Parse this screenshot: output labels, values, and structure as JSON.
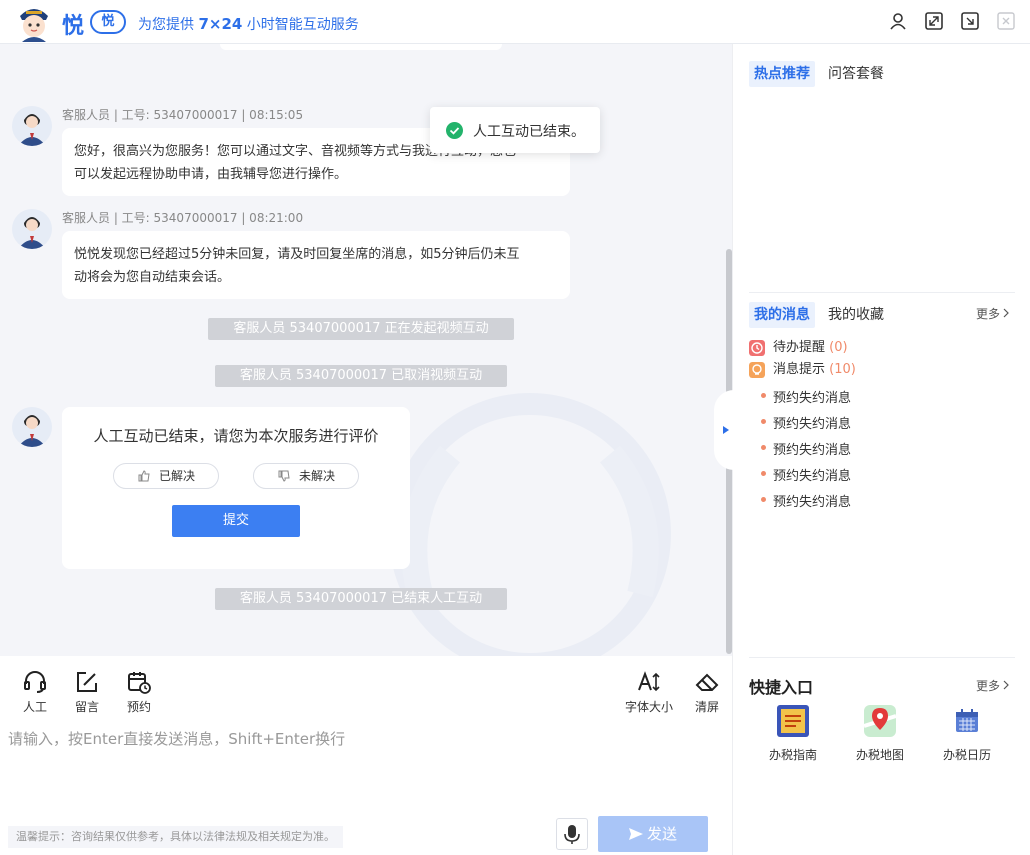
{
  "header": {
    "brand": "悦",
    "brand_badge": "悦",
    "slogan_prefix": "为您提供 ",
    "slogan_highlight": "7×24",
    "slogan_suffix": " 小时智能互动服务",
    "icons": [
      "user-icon",
      "expand-icon",
      "popout-icon",
      "close-icon"
    ]
  },
  "chat": {
    "messages": [
      {
        "meta": "客服人员 | 工号: 53407000017 | 08:15:05",
        "line1": "您好，很高兴为您服务！您可以通过文字、音视频等方式与我进行互动，您也",
        "line2": "可以发起远程协助申请，由我辅导您进行操作。"
      },
      {
        "meta": "客服人员 | 工号: 53407000017 | 08:21:00",
        "line1": "悦悦发现您已经超过5分钟未回复，请及时回复坐席的消息，如5分钟后仍未互",
        "line2": "动将会为您自动结束会话。"
      }
    ],
    "system_1": "客服人员 53407000017 正在发起视频互动",
    "system_2": "客服人员 53407000017 已取消视频互动",
    "system_3": "客服人员 53407000017 已结束人工互动",
    "evaluation": {
      "title": "人工互动已结束，请您为本次服务进行评价",
      "resolved": "已解决",
      "unresolved": "未解决",
      "submit": "提交"
    },
    "toast": "人工互动已结束。"
  },
  "toolbar": {
    "human": "人工",
    "message": "留言",
    "appointment": "预约",
    "font_size": "字体大小",
    "clear": "清屏"
  },
  "input": {
    "placeholder": "请输入，按Enter直接发送消息，Shift+Enter换行",
    "tip": "温馨提示：咨询结果仅供参考，具体以法律法规及相关规定为准。",
    "send": "发送"
  },
  "right": {
    "tabs_top": {
      "active": "热点推荐",
      "other": "问答套餐"
    },
    "tabs_msg": {
      "active": "我的消息",
      "other": "我的收藏",
      "more": "更多"
    },
    "todo_label": "待办提醒 ",
    "todo_count": "(0)",
    "notice_label": "消息提示 ",
    "notice_count": "(10)",
    "items": [
      "预约失约消息",
      "预约失约消息",
      "预约失约消息",
      "预约失约消息",
      "预约失约消息"
    ],
    "quick": {
      "title": "快捷入口",
      "more": "更多",
      "items": [
        "办税指南",
        "办税地图",
        "办税日历"
      ]
    }
  },
  "colors": {
    "accent": "#2d6fe8",
    "send_disabled": "#a9c5f7",
    "submit": "#3c7ff2",
    "success": "#23b36b",
    "count": "#f08a6a"
  }
}
